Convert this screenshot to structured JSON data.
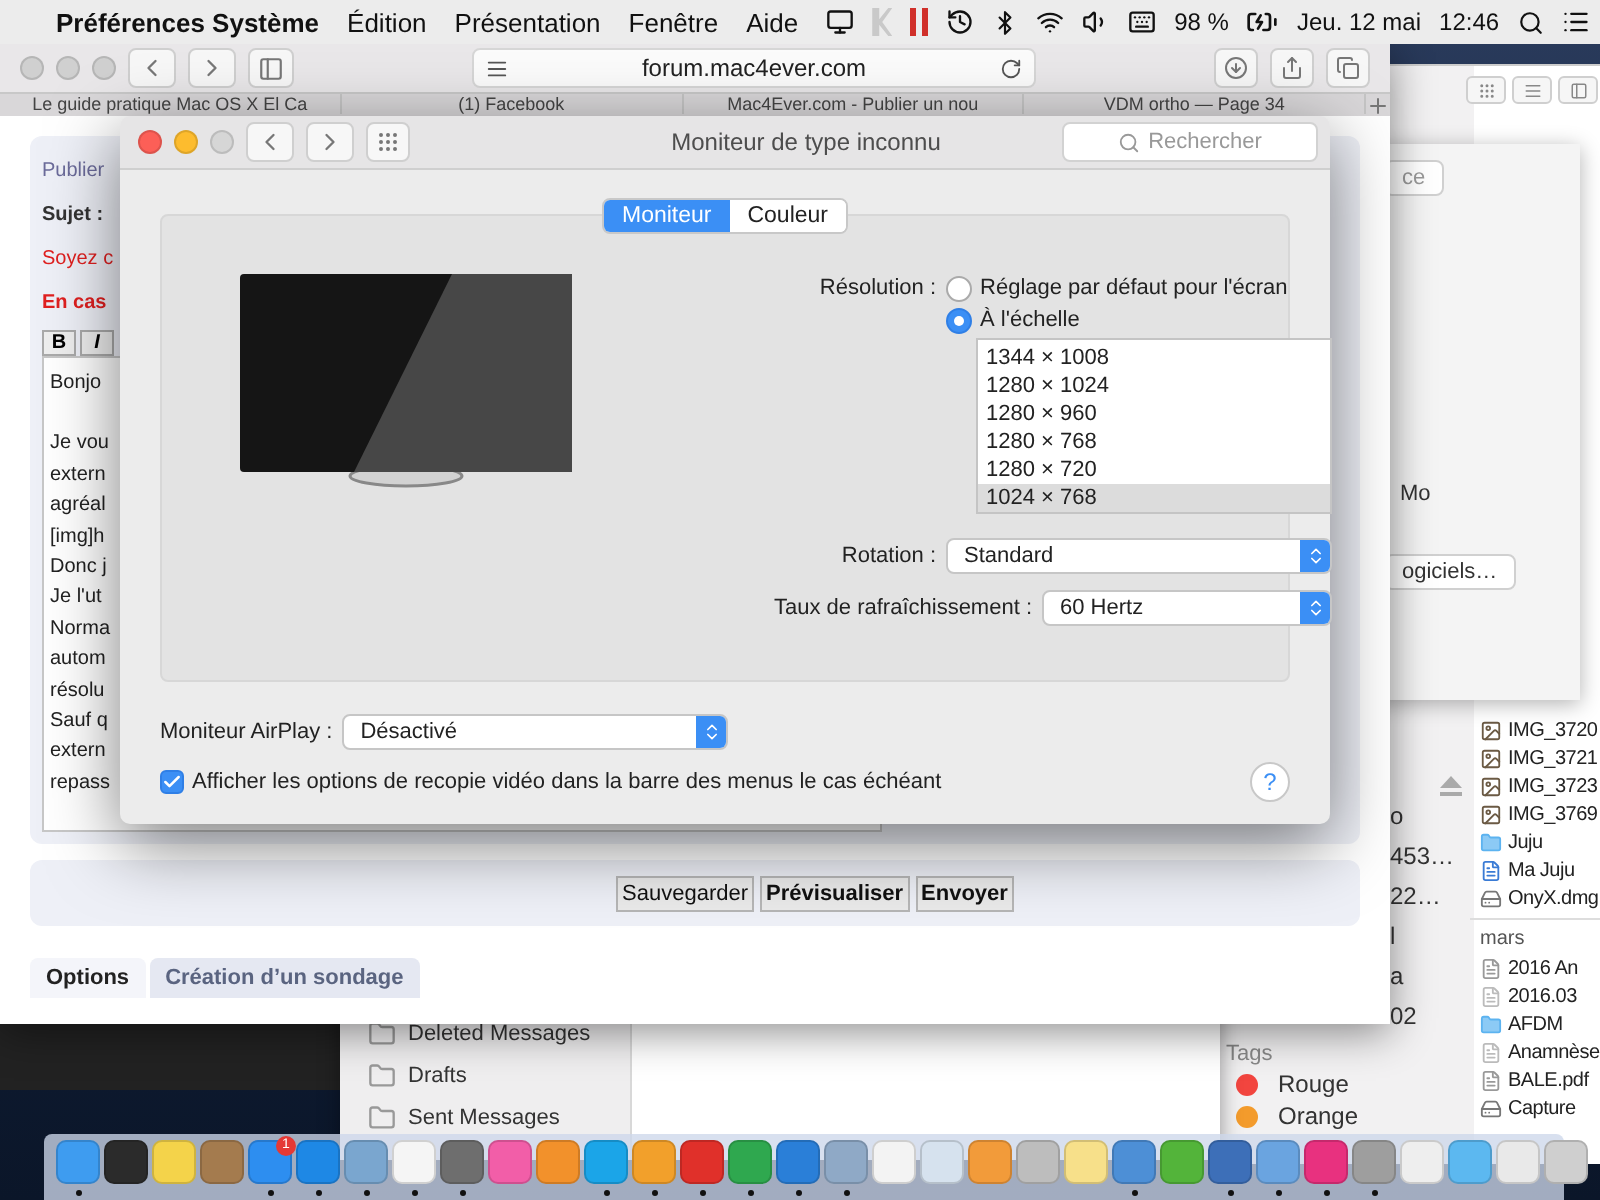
{
  "menu_bar": {
    "app": "Préférences Système",
    "menus": [
      "Édition",
      "Présentation",
      "Fenêtre",
      "Aide"
    ],
    "battery": "98 %",
    "date": "Jeu. 12 mai",
    "time": "12:46"
  },
  "browser": {
    "url": "forum.mac4ever.com",
    "tabs": [
      {
        "title": "Le guide pratique Mac OS X El Ca"
      },
      {
        "title": "(1) Facebook"
      },
      {
        "title": "Mac4Ever.com - Publier un nou"
      },
      {
        "title": "VDM ortho — Page 34"
      }
    ],
    "forum": {
      "heading": "Publier",
      "subject_label": "Sujet :",
      "warning": "Soyez c",
      "alert": "En cas",
      "format_buttons": [
        "B",
        "I"
      ],
      "greeting": "Bonjo",
      "lines": [
        "Je vou",
        "extern",
        "agréal",
        "[img]h",
        "Donc j",
        "Je l'ut",
        "Norma",
        "autom",
        "résolu",
        "Sauf q",
        "extern",
        "repass"
      ],
      "buttons": [
        {
          "label": "Sauvegarder",
          "primary": false
        },
        {
          "label": "Prévisualiser",
          "primary": true
        },
        {
          "label": "Envoyer",
          "primary": true
        }
      ],
      "tabs": [
        {
          "label": "Options",
          "selected": true
        },
        {
          "label": "Création d’un sondage",
          "selected": false
        }
      ]
    }
  },
  "mail": {
    "mailboxes": [
      "Deleted Messages",
      "Drafts",
      "Sent Messages"
    ]
  },
  "info_panel": {
    "button_fragment": "ce",
    "size_fragment": "Mo",
    "software_button": "ogiciels…"
  },
  "finder": {
    "sidebar_fragments": [
      "o",
      "453…",
      "22…",
      "l",
      "a",
      "02"
    ],
    "files": [
      {
        "name": "IMG_3720",
        "kind": "image"
      },
      {
        "name": "IMG_3721",
        "kind": "image"
      },
      {
        "name": "IMG_3723",
        "kind": "image"
      },
      {
        "name": "IMG_3769",
        "kind": "image"
      },
      {
        "name": "Juju",
        "kind": "folder"
      },
      {
        "name": "Ma Juju",
        "kind": "text"
      },
      {
        "name": "OnyX.dmg",
        "kind": "disk"
      },
      {
        "name": "mars",
        "kind": "section"
      },
      {
        "name": "2016 An",
        "kind": "pdf"
      },
      {
        "name": "2016.03",
        "kind": "doc"
      },
      {
        "name": "AFDM",
        "kind": "folder"
      },
      {
        "name": "Anamnèse",
        "kind": "doc"
      },
      {
        "name": "BALE.pdf",
        "kind": "pdf"
      },
      {
        "name": "Capture",
        "kind": "disk"
      }
    ],
    "tags_heading": "Tags",
    "tags": [
      {
        "label": "Rouge",
        "color": "#f2453f"
      },
      {
        "label": "Orange",
        "color": "#f39b2c"
      }
    ]
  },
  "dialog": {
    "title": "Moniteur de type inconnu",
    "search_placeholder": "Rechercher",
    "tabs": [
      {
        "label": "Moniteur",
        "selected": true
      },
      {
        "label": "Couleur",
        "selected": false
      }
    ],
    "resolution_label": "Résolution :",
    "resolution_modes": [
      {
        "label": "Réglage par défaut pour l'écran",
        "selected": false
      },
      {
        "label": "À l'échelle",
        "selected": true
      }
    ],
    "resolutions": [
      {
        "label": "1344 × 1008",
        "selected": false
      },
      {
        "label": "1280 × 1024",
        "selected": false
      },
      {
        "label": "1280 × 960",
        "selected": false
      },
      {
        "label": "1280 × 768",
        "selected": false
      },
      {
        "label": "1280 × 720",
        "selected": false
      },
      {
        "label": "1024 × 768",
        "selected": true
      }
    ],
    "rotation_label": "Rotation :",
    "rotation": "Standard",
    "refresh_label": "Taux de rafraîchissement :",
    "refresh": "60 Hertz",
    "airplay_label": "Moniteur AirPlay :",
    "airplay": "Désactivé",
    "mirroring_option": {
      "label": "Afficher les options de recopie vidéo dans la barre des menus le cas échéant",
      "checked": true
    },
    "help": "?"
  },
  "dock": {
    "apps": [
      {
        "color": "#3e9cf0",
        "running": true
      },
      {
        "color": "#2b2b2b",
        "running": false
      },
      {
        "color": "#f4d34a",
        "running": false
      },
      {
        "color": "#a47b4e",
        "running": false
      },
      {
        "color": "#2d8ef0",
        "running": true,
        "badge": "1"
      },
      {
        "color": "#1e88e5",
        "running": true
      },
      {
        "color": "#7aa6cf",
        "running": true
      },
      {
        "color": "#f5f5f5",
        "running": true
      },
      {
        "color": "#6e6e6e",
        "running": true
      },
      {
        "color": "#f25ea8",
        "running": false
      },
      {
        "color": "#f2912b",
        "running": false
      },
      {
        "color": "#1ba5e8",
        "running": true
      },
      {
        "color": "#f2a02b",
        "running": true
      },
      {
        "color": "#e0302a",
        "running": true
      },
      {
        "color": "#2fa84f",
        "running": true
      },
      {
        "color": "#2a7fd8",
        "running": true
      },
      {
        "color": "#8fa9c6",
        "running": true
      },
      {
        "color": "#f3f3f3",
        "running": false
      },
      {
        "color": "#d6e2ee",
        "running": false
      },
      {
        "color": "#f29b3a",
        "running": false
      },
      {
        "color": "#bdbdbd",
        "running": false
      },
      {
        "color": "#f7e08a",
        "running": false
      },
      {
        "color": "#4d8fd6",
        "running": true
      },
      {
        "color": "#53b43a",
        "running": false
      },
      {
        "color": "#3d6fb8",
        "running": true
      },
      {
        "color": "#6aa4e0",
        "running": true
      },
      {
        "color": "#e8317f",
        "running": true
      },
      {
        "color": "#9e9e9e",
        "running": true
      },
      {
        "color": "#eeeeee",
        "running": false
      },
      {
        "color": "#5cb8f0",
        "running": false
      },
      {
        "color": "#e9e9e9",
        "running": false
      },
      {
        "color": "#cfcfcf",
        "running": false
      }
    ]
  }
}
